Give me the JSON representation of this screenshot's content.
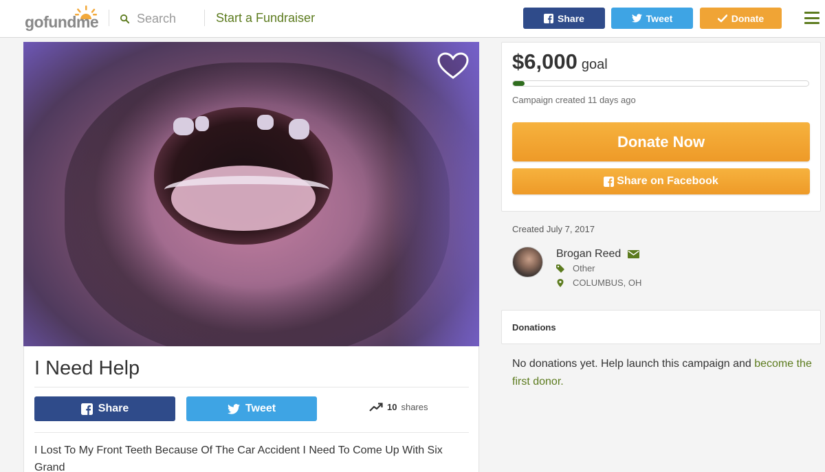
{
  "header": {
    "logo_text": "gofundme",
    "search_placeholder": "Search",
    "start_label": "Start a Fundraiser",
    "share_label": "Share",
    "tweet_label": "Tweet",
    "donate_label": "Donate"
  },
  "campaign": {
    "title": "I Need Help",
    "share_label": "Share",
    "tweet_label": "Tweet",
    "shares_count": "10",
    "shares_word": "shares",
    "story": "I Lost To My Front Teeth Because Of The Car Accident I Need To Come Up With Six Grand"
  },
  "sidebar": {
    "goal_amount": "$6,000",
    "goal_word": "goal",
    "progress_fraction": 0.04,
    "created_ago": "Campaign created 11 days ago",
    "donate_now_label": "Donate Now",
    "share_fb_label": "Share on Facebook",
    "created_date": "Created July 7, 2017",
    "owner_name": "Brogan Reed",
    "category": "Other",
    "location": "COLUMBUS, OH",
    "donations_title": "Donations",
    "donations_text": "No donations yet. Help launch this campaign and",
    "donations_link": "become the first donor."
  },
  "colors": {
    "brand_green": "#5c7b1e",
    "facebook_blue": "#2f4b8a",
    "twitter_blue": "#3ea4e4",
    "donate_orange": "#f0a435"
  },
  "icons": [
    "search-icon",
    "facebook-icon",
    "twitter-icon",
    "check-icon",
    "menu-icon",
    "heart-icon",
    "trending-icon",
    "envelope-icon",
    "tag-icon",
    "map-pin-icon"
  ]
}
